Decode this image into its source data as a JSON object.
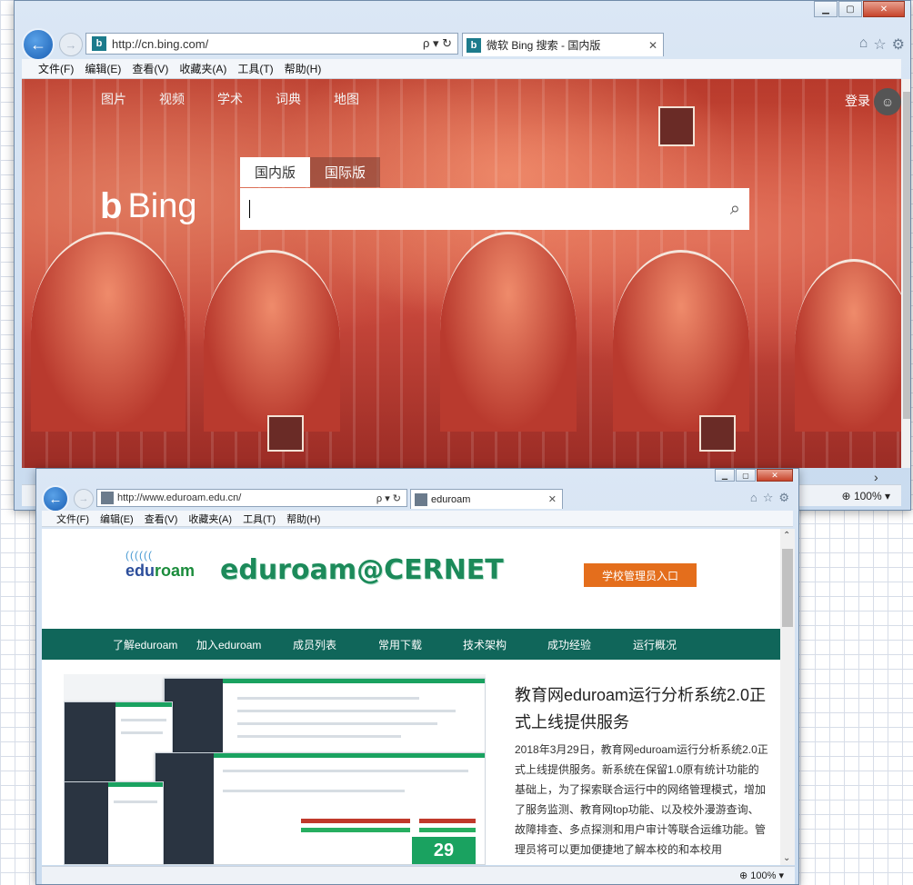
{
  "bing_window": {
    "url": "http://cn.bing.com/",
    "addr_controls": "ρ ▾ ↻",
    "tab_title": "微软 Bing 搜索 - 国内版",
    "tab_close": "✕",
    "menu": [
      "文件(F)",
      "编辑(E)",
      "查看(V)",
      "收藏夹(A)",
      "工具(T)",
      "帮助(H)"
    ],
    "zoom": "100%",
    "page": {
      "nav": [
        "图片",
        "视频",
        "学术",
        "词典",
        "地图"
      ],
      "login": "登录",
      "logo_text": "Bing",
      "search_tabs": [
        "国内版",
        "国际版"
      ],
      "search_value": ""
    }
  },
  "edu_window": {
    "url": "http://www.eduroam.edu.cn/",
    "addr_controls": "ρ ▾ ↻",
    "tab_title": "eduroam",
    "tab_close": "✕",
    "menu": [
      "文件(F)",
      "编辑(E)",
      "查看(V)",
      "收藏夹(A)",
      "工具(T)",
      "帮助(H)"
    ],
    "zoom": "100%",
    "page": {
      "logo_text_edu": "edu",
      "logo_text_roam": "roam",
      "brand": "eduroam@CERNET",
      "admin_button": "学校管理员入口",
      "nav": [
        "了解eduroam",
        "加入eduroam",
        "成员列表",
        "常用下载",
        "技术架构",
        "成功经验",
        "运行概况"
      ],
      "article_title": "教育网eduroam运行分析系统2.0正式上线提供服务",
      "article_body": "2018年3月29日，教育网eduroam运行分析系统2.0正式上线提供服务。新系统在保留1.0原有统计功能的基础上，为了探索联合运行中的网络管理模式，增加了服务监测、教育网top功能、以及校外漫游查询、故障排查、多点探测和用户审计等联合运维功能。管理员将可以更加便捷地了解本校的和本校用",
      "counter_value": "29"
    }
  },
  "colors": {
    "edu_nav": "#10665a",
    "edu_admin_btn": "#e46e1c",
    "ie_back": "#1a5fb4"
  }
}
